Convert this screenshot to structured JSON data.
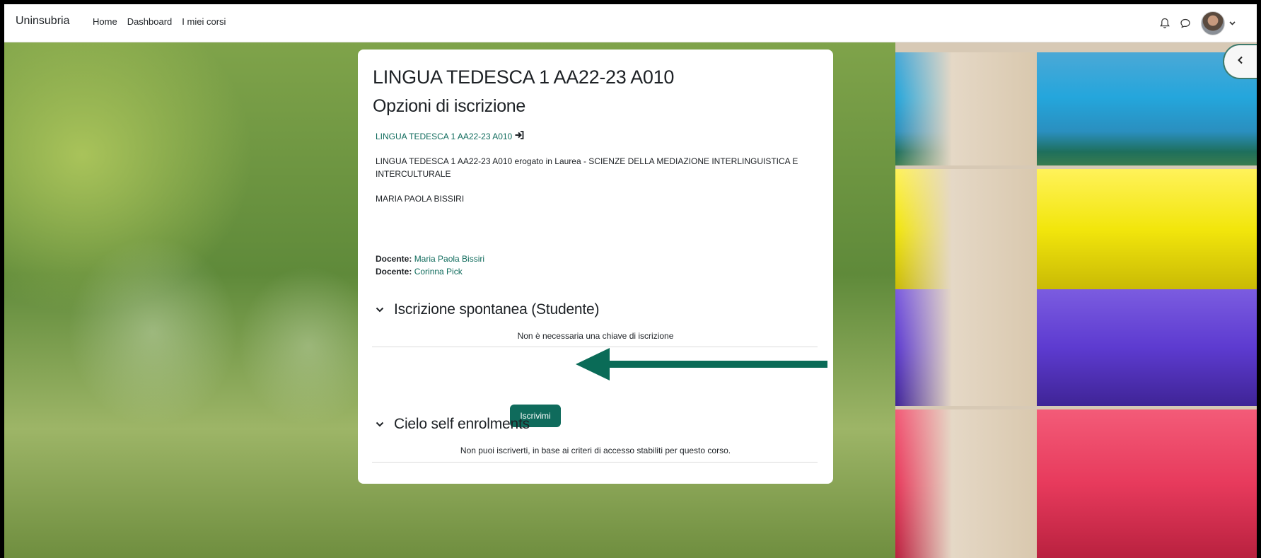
{
  "navbar": {
    "brand": "Uninsubria",
    "links": [
      "Home",
      "Dashboard",
      "I miei corsi"
    ]
  },
  "course": {
    "title": "LINGUA TEDESCA 1 AA22-23 A010",
    "heading": "Opzioni di iscrizione",
    "link_text": "LINGUA TEDESCA 1 AA22-23 A010",
    "summary": "LINGUA TEDESCA 1 AA22-23 A010 erogato in Laurea - SCIENZE DELLA MEDIAZIONE INTERLINGUISTICA E INTERCULTURALE",
    "teacher_name": "MARIA PAOLA BISSIRI",
    "contacts": [
      {
        "role": "Docente:",
        "name": "Maria Paola Bissiri"
      },
      {
        "role": "Docente:",
        "name": "Corinna Pick"
      }
    ]
  },
  "sections": [
    {
      "title": "Iscrizione spontanea (Studente)",
      "note": "Non è necessaria una chiave di iscrizione",
      "button": "Iscrivimi"
    },
    {
      "title": "Cielo self enrolments",
      "note": "Non puoi iscriverti, in base ai criteri di accesso stabiliti per questo corso."
    }
  ],
  "colors": {
    "accent": "#0f6b5c",
    "arrow": "#0a6b57",
    "pencil_blue": "#24a6dc",
    "pencil_yellow": "#f2e60c",
    "pencil_purple": "#5d3bd0",
    "pencil_red": "#e73a5c"
  },
  "icons": [
    "bell-icon",
    "chat-icon",
    "chevron-down-icon",
    "chevron-left-icon",
    "enter-icon",
    "arrow-annotation"
  ]
}
